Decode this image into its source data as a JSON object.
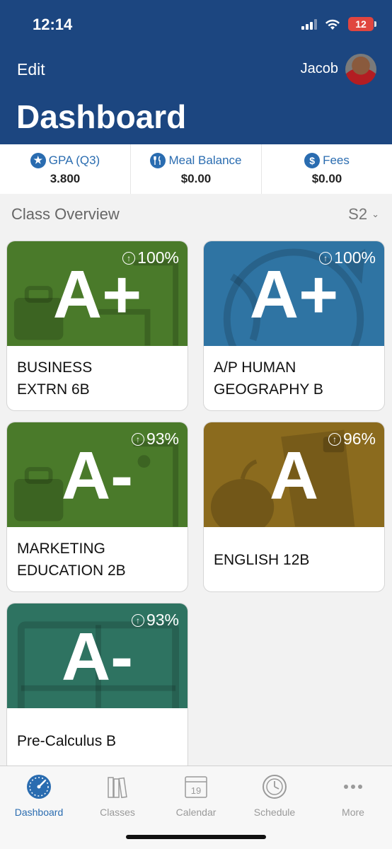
{
  "status_bar": {
    "time": "12:14",
    "battery": "12"
  },
  "header": {
    "edit_label": "Edit",
    "user_name": "Jacob",
    "title": "Dashboard"
  },
  "stats": [
    {
      "label": "GPA (Q3)",
      "value": "3.800",
      "icon": "star-icon"
    },
    {
      "label": "Meal Balance",
      "value": "$0.00",
      "icon": "utensils-icon"
    },
    {
      "label": "Fees",
      "value": "$0.00",
      "icon": "dollar-icon"
    }
  ],
  "overview": {
    "title": "Class Overview",
    "term": "S2"
  },
  "classes": [
    {
      "grade": "A+",
      "percent": "100%",
      "name": "BUSINESS\nEXTRN 6B",
      "color": "#4a7a2a"
    },
    {
      "grade": "A+",
      "percent": "100%",
      "name": "A/P HUMAN\nGEOGRAPHY B",
      "color": "#2f74a3"
    },
    {
      "grade": "A-",
      "percent": "93%",
      "name": "MARKETING\nEDUCATION 2B",
      "color": "#4a7a2a"
    },
    {
      "grade": "A",
      "percent": "96%",
      "name": "ENGLISH 12B",
      "color": "#8b6b1e"
    },
    {
      "grade": "A-",
      "percent": "93%",
      "name": "Pre-Calculus B",
      "color": "#2e7361"
    }
  ],
  "tabs": [
    {
      "label": "Dashboard",
      "icon": "gauge-icon",
      "active": true
    },
    {
      "label": "Classes",
      "icon": "books-icon",
      "active": false
    },
    {
      "label": "Calendar",
      "icon": "calendar-icon",
      "active": false,
      "date": "19"
    },
    {
      "label": "Schedule",
      "icon": "clock-icon",
      "active": false
    },
    {
      "label": "More",
      "icon": "more-icon",
      "active": false
    }
  ]
}
